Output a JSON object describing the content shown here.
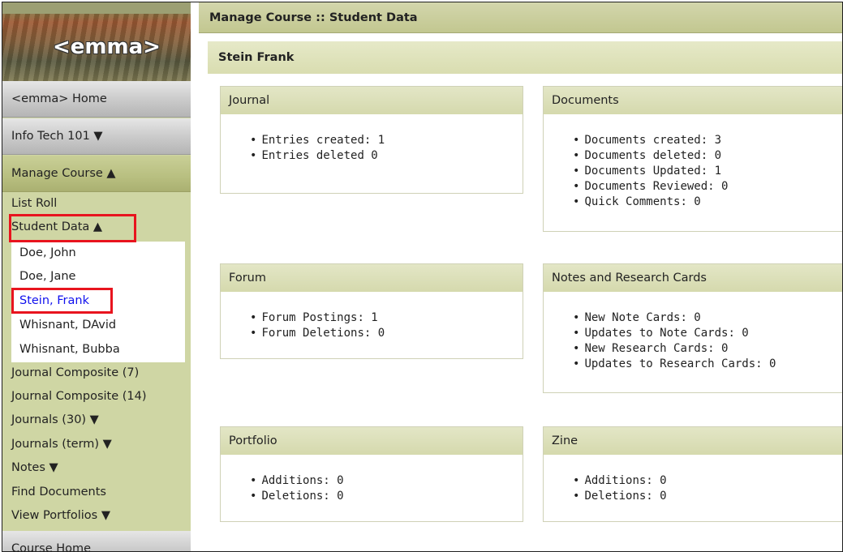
{
  "app": {
    "logo_text": "<emma>"
  },
  "sidebar": {
    "home": "<emma> Home",
    "course": "Info Tech 101  ▼",
    "manage_course": "Manage Course ▲",
    "list_roll": "List Roll",
    "student_data": "Student Data ▲",
    "students": [
      "Doe, John",
      "Doe, Jane",
      "Stein, Frank",
      "Whisnant, DAvid",
      "Whisnant, Bubba"
    ],
    "items": [
      "Journal Composite (7)",
      "Journal Composite (14)",
      "Journals (30) ▼",
      "Journals (term) ▼",
      "Notes ▼",
      "Find Documents",
      "View Portfolios ▼"
    ],
    "course_home": "Course Home"
  },
  "main": {
    "header": "Manage Course :: Student Data",
    "student_name": "Stein Frank",
    "panels": [
      {
        "title": "Journal",
        "items": [
          "Entries created: 1",
          "Entries deleted 0"
        ]
      },
      {
        "title": "Documents",
        "items": [
          "Documents created: 3",
          "Documents deleted: 0",
          "Documents Updated: 1",
          "Documents Reviewed: 0",
          "Quick Comments: 0"
        ]
      },
      {
        "title": "Forum",
        "items": [
          "Forum Postings: 1",
          "Forum Deletions: 0"
        ]
      },
      {
        "title": "Notes and Research Cards",
        "items": [
          "New Note Cards: 0",
          "Updates to Note Cards: 0",
          "New Research Cards: 0",
          "Updates to Research Cards: 0"
        ]
      },
      {
        "title": "Portfolio",
        "items": [
          "Additions: 0",
          "Deletions: 0"
        ]
      },
      {
        "title": "Zine",
        "items": [
          "Additions: 0",
          "Deletions: 0"
        ]
      }
    ]
  },
  "colors": {
    "sidebar_bg": "#cfd6a4",
    "header_bg": "#c2c790",
    "highlight_red": "#e8141e",
    "active_link": "#1010ee"
  }
}
